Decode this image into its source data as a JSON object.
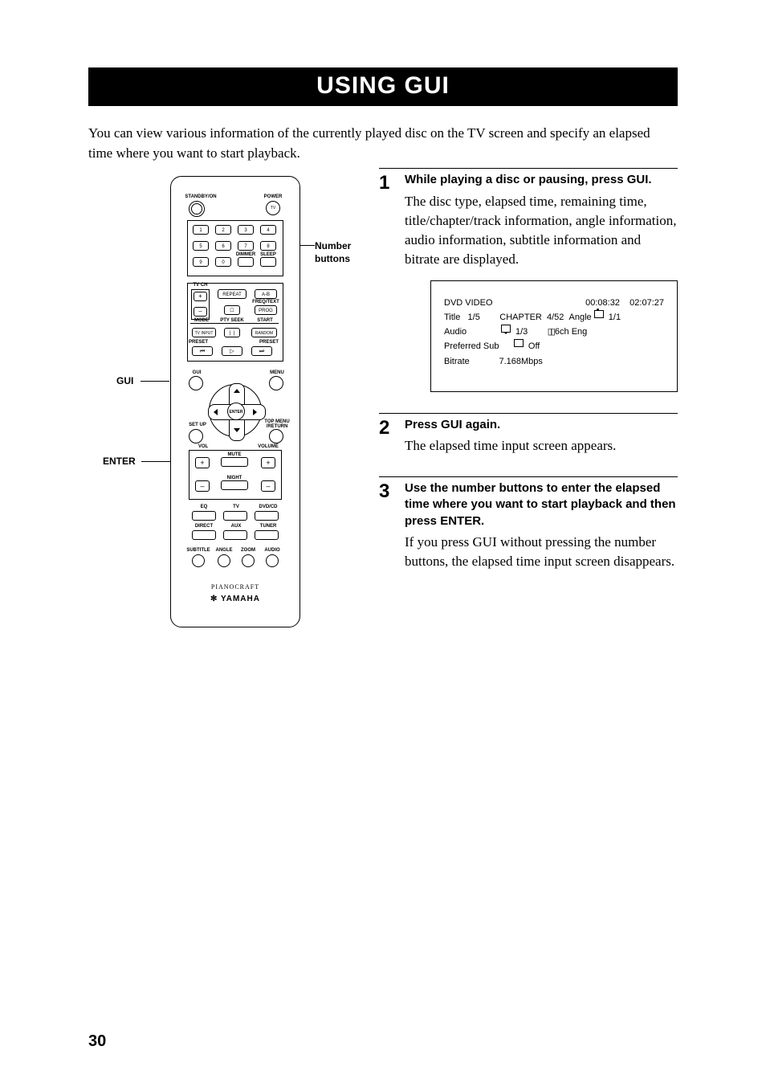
{
  "page": {
    "title": "USING GUI",
    "intro": "You can view various information of the currently played disc on the TV screen and specify an elapsed time where you want to start playback.",
    "number": "30"
  },
  "callouts": {
    "numbers": "Number\nbuttons",
    "gui": "GUI",
    "enter": "ENTER"
  },
  "remote": {
    "standby": "STANDBY/ON",
    "power": "POWER",
    "tv": "TV",
    "nums": [
      "1",
      "2",
      "3",
      "4",
      "5",
      "6",
      "7",
      "8",
      "9",
      "0"
    ],
    "dimmer": "DIMMER",
    "sleep": "SLEEP",
    "tvch": "TV CH",
    "plus": "+",
    "minus": "–",
    "repeat": "REPEAT",
    "ab": "A-B",
    "freq": "FREQ/TEXT",
    "prog": "PROG",
    "mode": "MODE",
    "ptyseek": "PTY SEEK",
    "start": "START",
    "tvinput": "TV INPUT",
    "random": "RANDOM",
    "preset": "PRESET",
    "gui": "GUI",
    "menu": "MENU",
    "enter": "ENTER",
    "setup": "SET UP",
    "topmenu": "TOP MENU\n/RETURN",
    "vol": "VOL",
    "volume": "VOLUME",
    "mute": "MUTE",
    "night": "NIGHT",
    "eq": "EQ",
    "tvsrc": "TV",
    "dvdcd": "DVD/CD",
    "direct": "DIRECT",
    "aux": "AUX",
    "tuner": "TUNER",
    "subtitle": "SUBTITLE",
    "angle": "ANGLE",
    "zoom": "ZOOM",
    "audio": "AUDIO",
    "brand1": "PIANOCRAFT",
    "brand2": "YAMAHA"
  },
  "steps": [
    {
      "n": "1",
      "head": "While playing a disc or pausing, press GUI.",
      "body": "The disc type, elapsed time, remaining time, title/chapter/track information, angle information, audio information, subtitle information and bitrate are displayed."
    },
    {
      "n": "2",
      "head": "Press GUI again.",
      "body": "The elapsed time input screen appears."
    },
    {
      "n": "3",
      "head": "Use the number buttons to enter the elapsed time where you want to start playback and then press ENTER.",
      "body": "If you press GUI without pressing the number buttons, the elapsed time input screen disappears."
    }
  ],
  "osd": {
    "disc": "DVD VIDEO",
    "elapsed": "00:08:32",
    "remain": "02:07:27",
    "titleLbl": "Title",
    "title": "1/5",
    "chapLbl": "CHAPTER",
    "chap": "4/52",
    "angLbl": "Angle",
    "ang": "1/1",
    "audLbl": "Audio",
    "aud1": "1/3",
    "aud2": "6ch Eng",
    "subLbl": "Preferred Sub",
    "sub": "Off",
    "brLbl": "Bitrate",
    "br": "7.168Mbps"
  }
}
